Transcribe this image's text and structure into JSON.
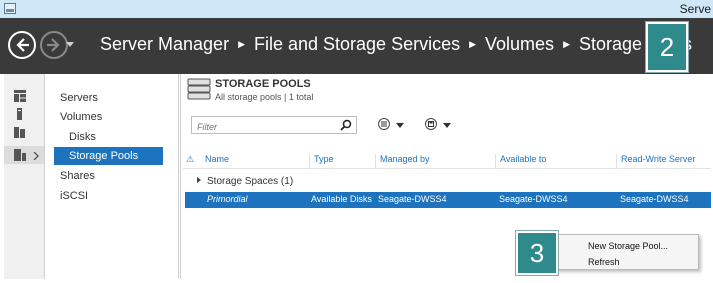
{
  "window": {
    "title": "Serve"
  },
  "header": {
    "breadcrumb": [
      "Server Manager",
      "File and Storage Services",
      "Volumes",
      "Storage Pools"
    ]
  },
  "badges": {
    "step2": "2",
    "step3": "3"
  },
  "nav": {
    "items": [
      "Servers",
      "Volumes",
      "Disks",
      "Storage Pools",
      "Shares",
      "iSCSI"
    ],
    "active": "Storage Pools"
  },
  "tile": {
    "title": "STORAGE POOLS",
    "subtitle": "All storage pools | 1 total"
  },
  "filter": {
    "placeholder": "Filter"
  },
  "table": {
    "columns": [
      "Name",
      "Type",
      "Managed by",
      "Available to",
      "Read-Write Server"
    ],
    "group_label": "Storage Spaces (1)",
    "rows": [
      {
        "name": "Primordial",
        "type": "Available Disks",
        "managed_by": "Seagate-DWSS4",
        "available_to": "Seagate-DWSS4",
        "rw_server": "Seagate-DWSS4"
      }
    ]
  },
  "context_menu": {
    "items": [
      "New Storage Pool...",
      "Refresh"
    ]
  },
  "colors": {
    "accent": "#1e73be",
    "header_bg": "#3a3a3a",
    "badge": "#2f8a8c"
  },
  "icons": [
    "server-manager-icon",
    "back-icon",
    "forward-icon",
    "dashboard-icon",
    "local-server-icon",
    "all-servers-icon",
    "file-storage-icon",
    "storage-pools-icon",
    "search-icon",
    "list-view-icon",
    "save-view-icon",
    "warning-icon",
    "collapse-icon"
  ]
}
